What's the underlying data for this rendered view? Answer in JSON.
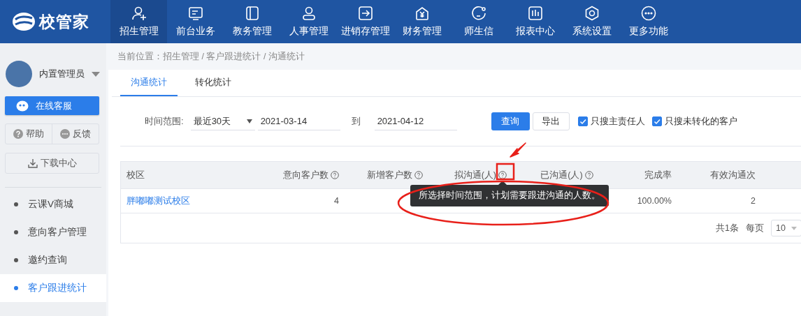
{
  "logo": {
    "text": "校管家"
  },
  "nav": [
    {
      "label": "招生管理",
      "selected": true
    },
    {
      "label": "前台业务",
      "selected": false
    },
    {
      "label": "教务管理",
      "selected": false
    },
    {
      "label": "人事管理",
      "selected": false
    },
    {
      "label": "进销存管理",
      "selected": false
    },
    {
      "label": "财务管理",
      "selected": false
    },
    {
      "label": "师生信",
      "selected": false
    },
    {
      "label": "报表中心",
      "selected": false
    },
    {
      "label": "系统设置",
      "selected": false
    },
    {
      "label": "更多功能",
      "selected": false
    }
  ],
  "user": {
    "name": "内置管理员"
  },
  "sidebar": {
    "service_button": "在线客服",
    "help": "帮助",
    "feedback": "反馈",
    "download": "下载中心",
    "items": [
      {
        "label": "云课V商城",
        "selected": false
      },
      {
        "label": "意向客户管理",
        "selected": false
      },
      {
        "label": "邀约查询",
        "selected": false
      },
      {
        "label": "客户跟进统计",
        "selected": true
      }
    ]
  },
  "breadcrumb": "当前位置：招生管理 / 客户跟进统计 / 沟通统计",
  "tabs": [
    {
      "label": "沟通统计",
      "selected": true
    },
    {
      "label": "转化统计",
      "selected": false
    }
  ],
  "filters": {
    "range_label": "时间范围:",
    "range_select": "最近30天",
    "start_date": "2021-03-14",
    "to": "到",
    "end_date": "2021-04-12",
    "query_button": "查询",
    "export_button": "导出",
    "checkboxes": [
      {
        "label": "只搜主责任人",
        "checked": true
      },
      {
        "label": "只搜未转化的客户",
        "checked": true
      }
    ]
  },
  "table": {
    "columns": [
      {
        "label": "校区",
        "help": false
      },
      {
        "label": "意向客户数",
        "help": true
      },
      {
        "label": "新增客户数",
        "help": true
      },
      {
        "label": "拟沟通(人)",
        "help": true
      },
      {
        "label": "已沟通(人)",
        "help": true
      },
      {
        "label": "完成率",
        "help": false
      },
      {
        "label": "有效沟通次",
        "help": false
      }
    ],
    "rows": [
      {
        "campus": "胖嘟嘟测试校区",
        "intent_customers": "4",
        "completion_rate": "100.00%",
        "effective_count": "2"
      }
    ]
  },
  "tooltip": "所选择时间范围，计划需要跟进沟通的人数。",
  "pagination": {
    "total": "共1条",
    "per_page_label": "每页",
    "page_size": "10"
  }
}
